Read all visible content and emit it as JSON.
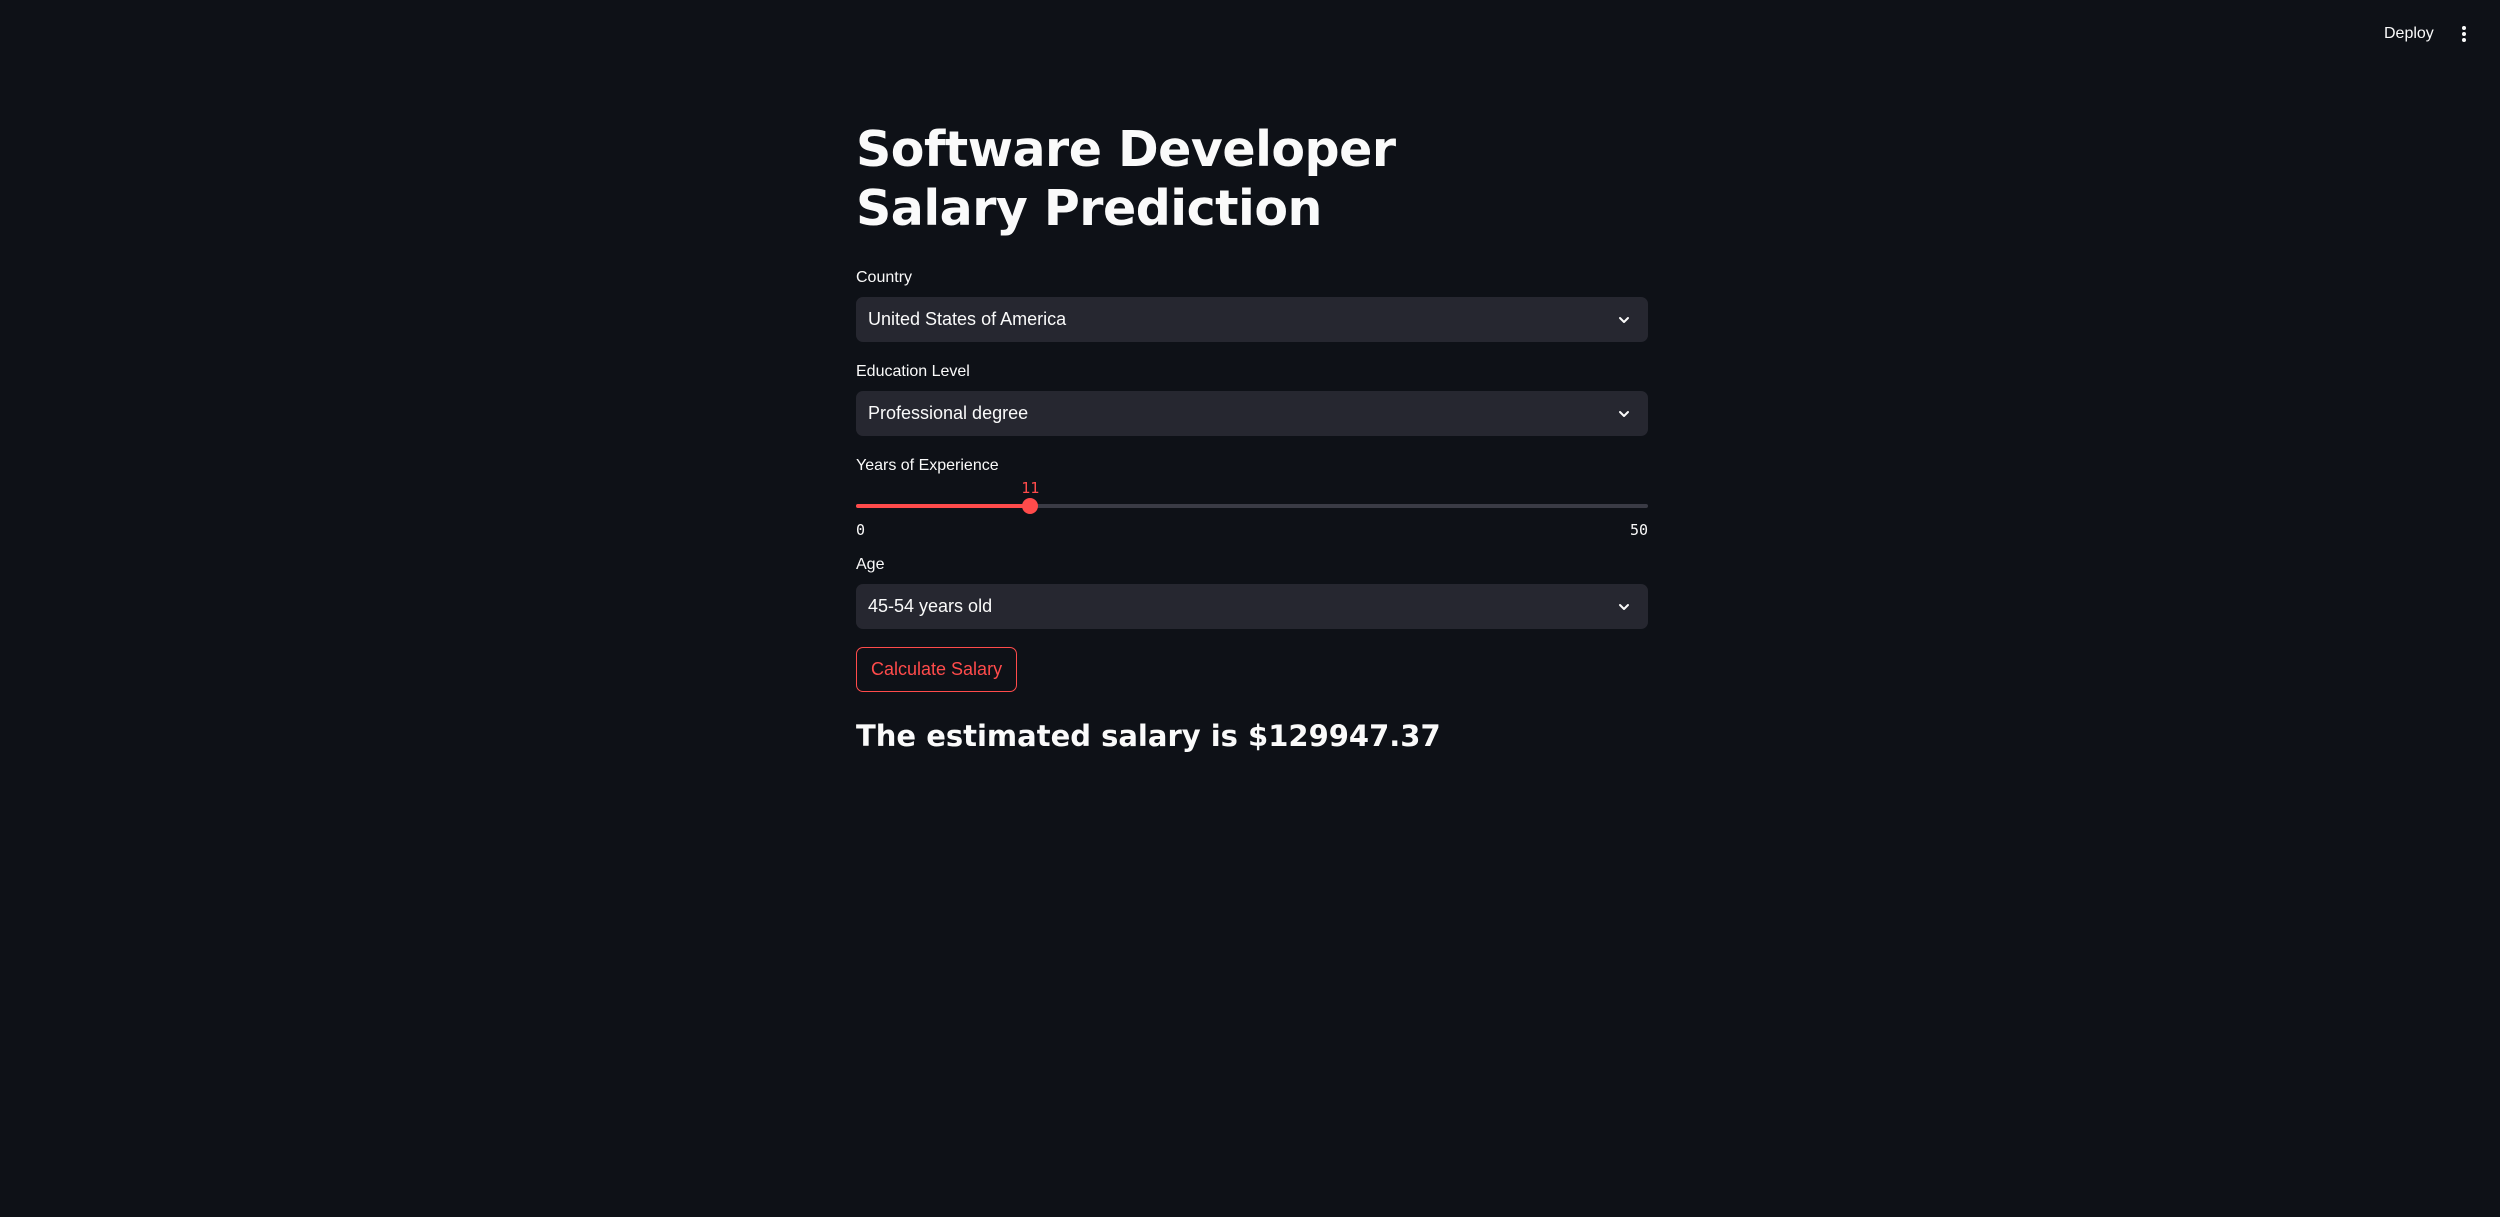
{
  "header": {
    "deploy_label": "Deploy",
    "menu_icon": "vertical-ellipsis-icon"
  },
  "page": {
    "title": "Software Developer Salary Prediction"
  },
  "form": {
    "country": {
      "label": "Country",
      "value": "United States of America"
    },
    "education": {
      "label": "Education Level",
      "value": "Professional degree"
    },
    "experience": {
      "label": "Years of Experience",
      "value": 11,
      "min": 0,
      "max": 50
    },
    "age": {
      "label": "Age",
      "value": "45-54 years old"
    },
    "calculate_label": "Calculate Salary"
  },
  "result": {
    "text": "The estimated salary is $129947.37"
  },
  "colors": {
    "background": "#0e1117",
    "input_bg": "#262730",
    "accent": "#ff4b4b",
    "text": "#fafafa"
  }
}
